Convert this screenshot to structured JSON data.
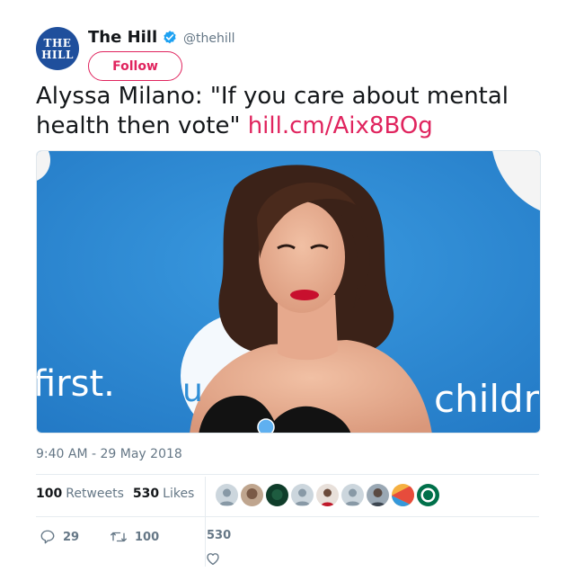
{
  "account": {
    "logo_line1": "THE",
    "logo_line2": "HILL",
    "name": "The Hill",
    "handle": "@thehill",
    "follow_label": "Follow"
  },
  "tweet": {
    "text": "Alyssa Milano: \"If you care about mental health then vote\"",
    "link": "hill.cm/Aix8BOg",
    "timestamp": "9:40 AM - 29 May 2018"
  },
  "media": {
    "sign_left": "first.",
    "sign_right": "childre",
    "sign_mid": "u"
  },
  "stats": {
    "retweets_count": "100",
    "retweets_label": "Retweets",
    "likes_count": "530",
    "likes_label": "Likes"
  },
  "actions": {
    "replies": "29",
    "retweets": "100",
    "likes": "530"
  },
  "colors": {
    "accent": "#e0245e",
    "verified": "#1da1f2",
    "brand": "#1f4f9c",
    "backdrop": "#2f8fd6"
  }
}
